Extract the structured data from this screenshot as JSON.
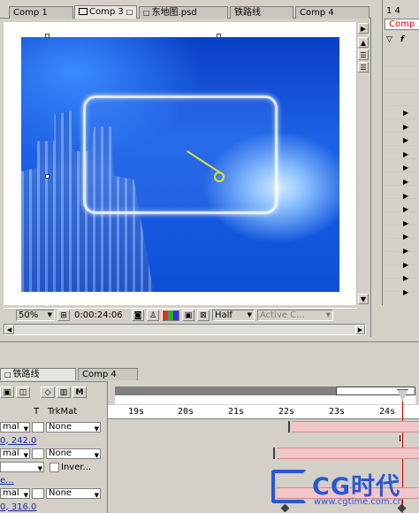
{
  "comp_tabs": [
    "Comp 1",
    "Comp 3",
    "东地图.psd",
    "铁路线",
    "Comp 4"
  ],
  "active_comp_tab_index": 1,
  "status_bar": {
    "zoom": "50%",
    "timecode": "0:00:24:06",
    "resolution": "Half",
    "camera": "Active C..."
  },
  "project_panel": {
    "tab_label": "1 4",
    "selected_item": "Comp",
    "header_glyph": "f"
  },
  "timeline": {
    "tabs": [
      "铁路线",
      "Comp 4"
    ],
    "active_tab_index": 0,
    "columns": {
      "t": "T",
      "trkmat": "TrkMat"
    },
    "toolbar_letter": "M",
    "time_ticks": [
      "19s",
      "20s",
      "21s",
      "22s",
      "23s",
      "24s"
    ],
    "rows": [
      {
        "mode": "mal",
        "trkmat": "None"
      },
      {
        "value": "0, 242.0"
      },
      {
        "mode": "mal",
        "trkmat": "None"
      },
      {
        "invert_label": "Inver..."
      },
      {
        "value": "e..."
      },
      {
        "mode": "mal",
        "trkmat": "None"
      },
      {
        "value": "0, 316.0"
      }
    ]
  },
  "watermark": {
    "brand": "CG时代",
    "url": "www.cgtime.com.cn"
  },
  "colors": {
    "panel_bg": "#d4d0c8",
    "timeline_bar": "#f2c6c6",
    "playhead": "#dd0000",
    "motion_path": "#e8e030",
    "value_text": "#1a2fa8"
  }
}
